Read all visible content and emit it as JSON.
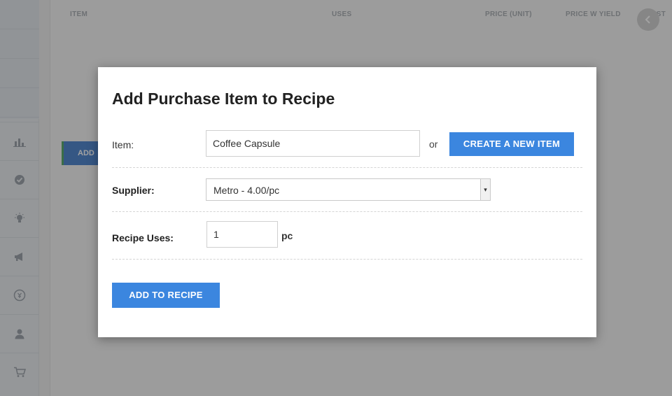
{
  "background": {
    "table_headers": [
      "ITEM",
      "USES",
      "PRICE (UNIT)",
      "PRICE W YIELD",
      "COST"
    ],
    "add_button_label": "ADD"
  },
  "modal": {
    "title": "Add Purchase Item to Recipe",
    "item": {
      "label": "Item:",
      "value": "Coffee Capsule",
      "or_text": "or",
      "create_button": "CREATE A NEW ITEM"
    },
    "supplier": {
      "label": "Supplier:",
      "selected": "Metro - 4.00/pc"
    },
    "recipe_uses": {
      "label": "Recipe Uses:",
      "value": "1",
      "unit": "pc"
    },
    "submit_button": "ADD TO RECIPE"
  },
  "colors": {
    "primary_button": "#3b86df",
    "background_add_button": "#2f6fc6"
  },
  "icons": {
    "sidebar": [
      "chart-icon",
      "check-circle-icon",
      "lightbulb-icon",
      "megaphone-icon",
      "currency-icon",
      "user-icon",
      "cart-icon"
    ],
    "top_right": "chevron-left-icon"
  }
}
